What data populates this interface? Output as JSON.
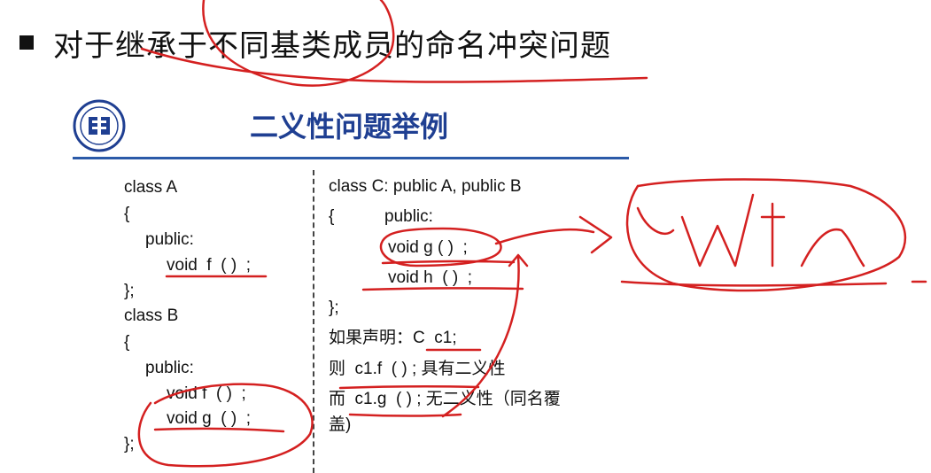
{
  "heading": "对于继承于不同基类成员的命名冲突问题",
  "slide_title": "二义性问题举例",
  "left_code": {
    "class_a": "class A",
    "brace_open_a": "{",
    "public_a": "public:",
    "void_f": "void  f  ( )  ;",
    "brace_close_a": "};",
    "class_b": "class B",
    "brace_open_b": "{",
    "public_b": "public:",
    "void_f_b": "void f  ( )  ;",
    "void_g_b": "void g  ( )  ;",
    "brace_close_b": "};"
  },
  "right_code": {
    "class_c": "class C: public A, public B",
    "brace_open": "{",
    "public_c": "public:",
    "void_g": "void g ( )  ;",
    "void_h": "void h  ( )  ;",
    "brace_close": "};",
    "declare": "如果声明：C  c1;",
    "then_line": "则  c1.f  ( ) ; 具有二义性",
    "and_line": "而  c1.g  ( ) ; 无二义性（同名覆",
    "and_line_cont": "盖)"
  },
  "colors": {
    "title_blue": "#1f3f92",
    "rule_blue": "#2b5aa8",
    "ink_red": "#d42020"
  },
  "icons": {
    "logo": "university-emblem-icon"
  }
}
